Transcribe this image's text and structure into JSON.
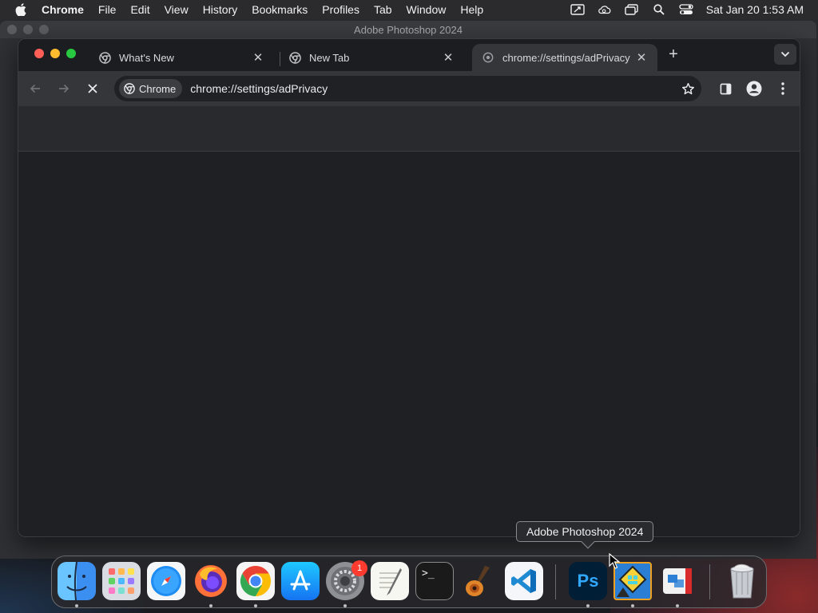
{
  "menubar": {
    "app_name": "Chrome",
    "items": [
      "File",
      "Edit",
      "View",
      "History",
      "Bookmarks",
      "Profiles",
      "Tab",
      "Window",
      "Help"
    ],
    "clock": "Sat Jan 20  1:53 AM",
    "status_icons": [
      "display-icon",
      "creative-cloud-icon",
      "window-icon",
      "search-icon",
      "control-center-icon"
    ]
  },
  "photoshop_window": {
    "title": "Adobe Photoshop 2024"
  },
  "chrome": {
    "tabs": [
      {
        "title": "What's New",
        "favicon": "chrome-icon",
        "active": false
      },
      {
        "title": "New Tab",
        "favicon": "chrome-icon",
        "active": false
      },
      {
        "title": "chrome://settings/adPrivacy",
        "favicon": "settings-icon",
        "active": true
      }
    ],
    "omnibox": {
      "chip_label": "Chrome",
      "url": "chrome://settings/adPrivacy"
    },
    "page_loading": true
  },
  "dock": {
    "tooltip": "Adobe Photoshop 2024",
    "apps": [
      {
        "name": "Finder",
        "icon": "finder-icon",
        "running": true
      },
      {
        "name": "Launchpad",
        "icon": "launchpad-icon",
        "running": false
      },
      {
        "name": "Safari",
        "icon": "safari-icon",
        "running": false
      },
      {
        "name": "Firefox",
        "icon": "firefox-icon",
        "running": true
      },
      {
        "name": "Google Chrome",
        "icon": "chrome-icon",
        "running": true
      },
      {
        "name": "App Store",
        "icon": "app-store-icon",
        "running": false
      },
      {
        "name": "System Settings",
        "icon": "system-settings-icon",
        "running": true,
        "badge": "1"
      },
      {
        "name": "TextEdit",
        "icon": "textedit-icon",
        "running": false
      },
      {
        "name": "Terminal",
        "icon": "terminal-icon",
        "running": false
      },
      {
        "name": "GarageBand",
        "icon": "garageband-icon",
        "running": false
      },
      {
        "name": "Visual Studio Code",
        "icon": "vscode-icon",
        "running": false
      },
      {
        "name": "Adobe Photoshop 2024",
        "icon": "photoshop-icon",
        "running": true
      },
      {
        "name": "Geometry Dash",
        "icon": "geometry-dash-icon",
        "running": true
      },
      {
        "name": "Parallels",
        "icon": "parallels-icon",
        "running": true
      },
      {
        "name": "Trash",
        "icon": "trash-icon",
        "running": false
      }
    ],
    "photoshop_label": "Ps",
    "terminal_prompt": ">_"
  },
  "colors": {
    "accent_red": "#ff5f57",
    "accent_yellow": "#febc2e",
    "accent_green": "#28c840",
    "chrome_toolbar": "#35363a"
  }
}
